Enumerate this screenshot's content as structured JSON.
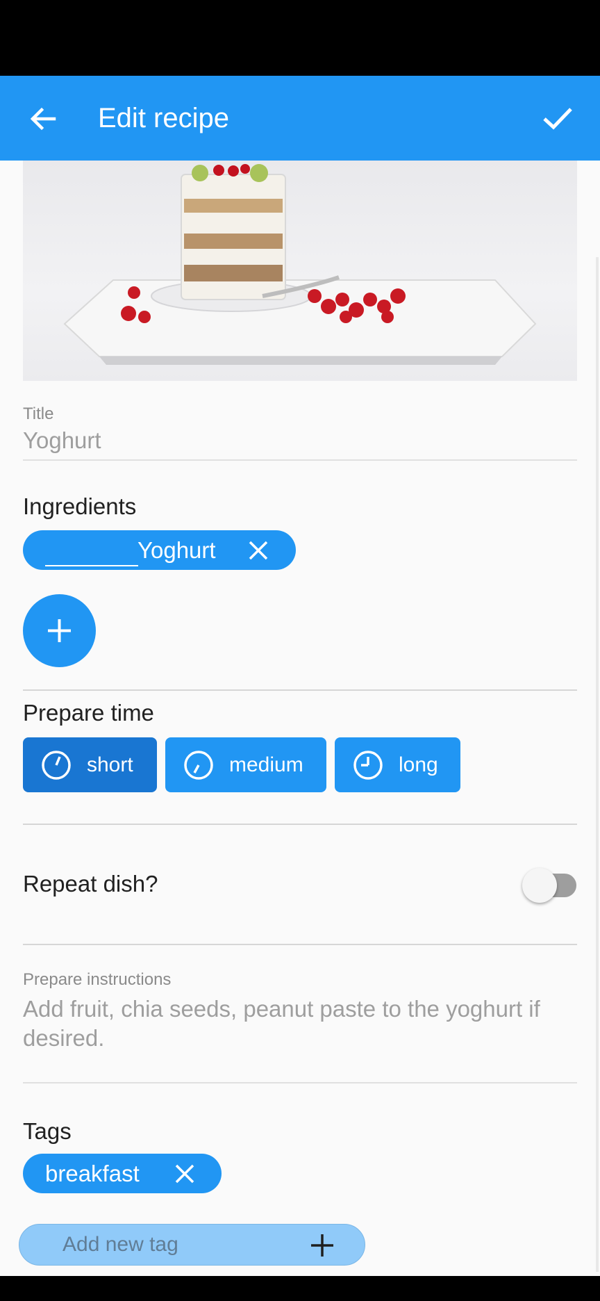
{
  "app_bar": {
    "title": "Edit recipe",
    "back_icon": "arrow-left-icon",
    "save_icon": "check-icon",
    "color": "#2196f3"
  },
  "photo": {
    "description_icon": "recipe-photo"
  },
  "title_field": {
    "label": "Title",
    "value": "Yoghurt"
  },
  "ingredients": {
    "heading": "Ingredients",
    "items": [
      {
        "label": "Yoghurt",
        "remove_icon": "close-icon"
      }
    ],
    "add_icon": "plus-icon"
  },
  "prepare_time": {
    "heading": "Prepare time",
    "options": [
      {
        "label": "short",
        "icon": "clock-icon",
        "selected": true
      },
      {
        "label": "medium",
        "icon": "clock-icon",
        "selected": false
      },
      {
        "label": "long",
        "icon": "clock-icon",
        "selected": false
      }
    ]
  },
  "repeat": {
    "label": "Repeat dish?",
    "enabled": false
  },
  "instructions": {
    "label": "Prepare instructions",
    "value": "Add fruit, chia seeds, peanut paste to the yoghurt if desired."
  },
  "tags": {
    "heading": "Tags",
    "items": [
      {
        "label": "breakfast",
        "remove_icon": "close-icon"
      }
    ],
    "new_tag_placeholder": "Add new tag",
    "add_icon": "plus-icon"
  }
}
